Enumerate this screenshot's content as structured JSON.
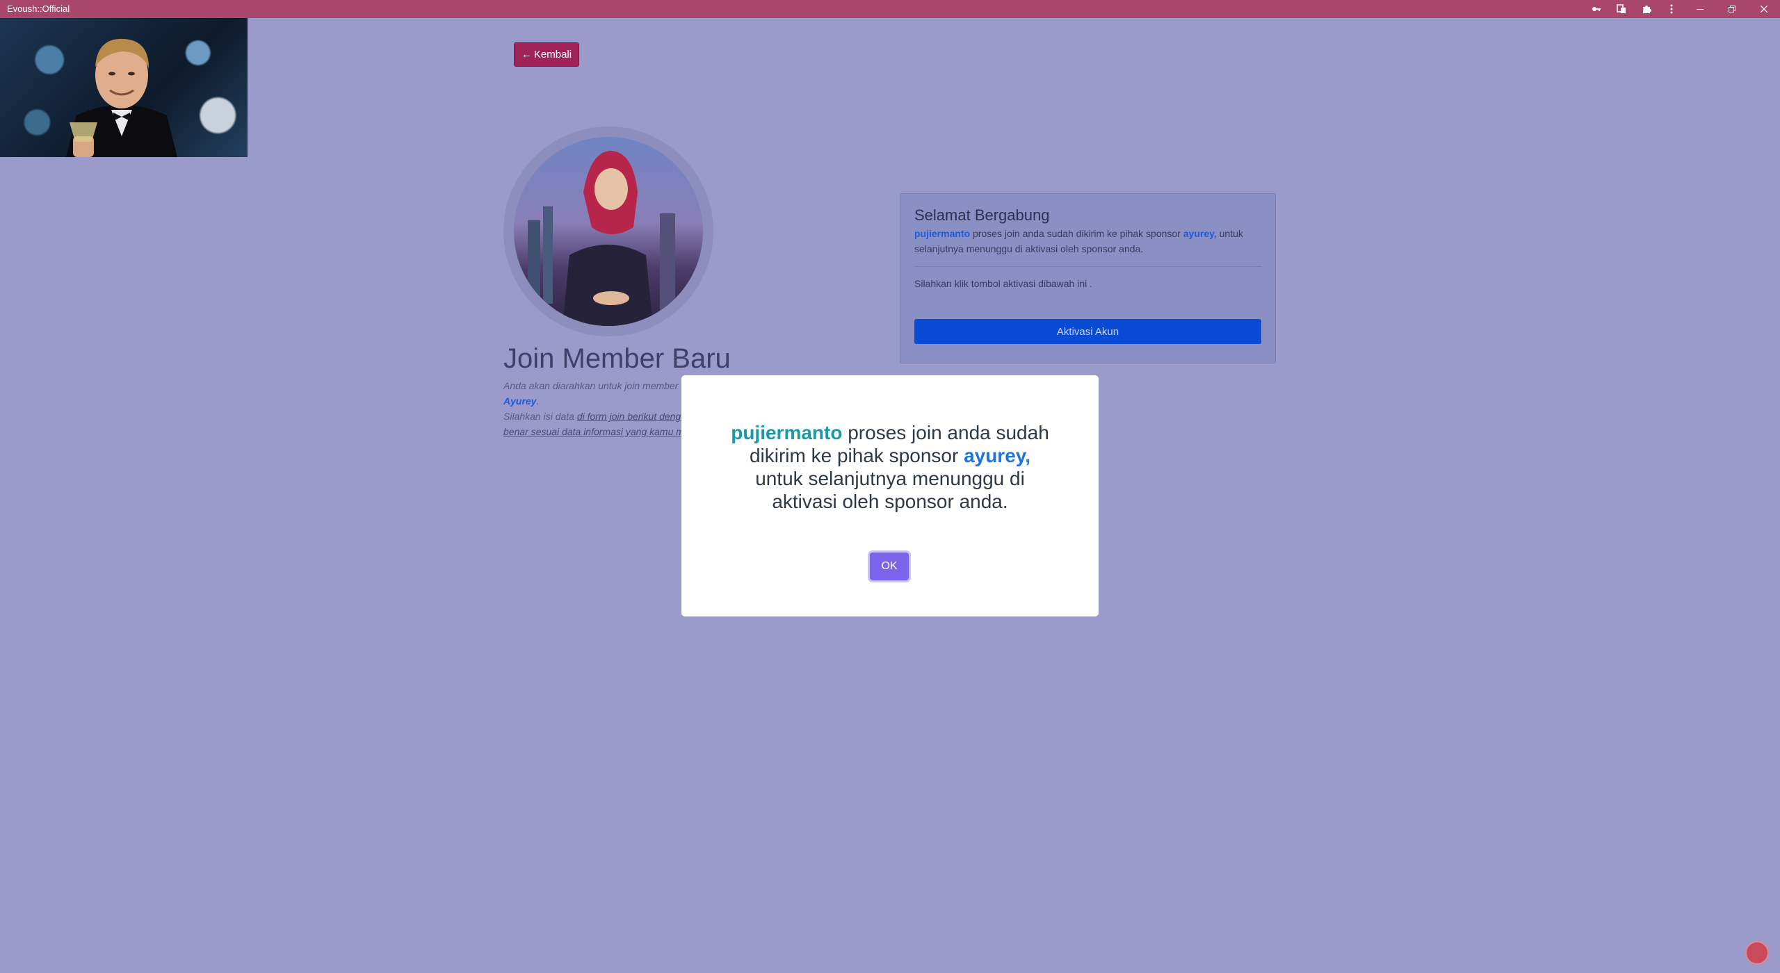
{
  "window": {
    "title": "Evoush::Official"
  },
  "back_button": {
    "label": "Kembali",
    "arrow": "←"
  },
  "join": {
    "title": "Join Member Baru",
    "line1": "Anda akan diarahkan untuk join member",
    "sponsor": "Ayurey",
    "line3_prefix": "Silahkan isi data ",
    "line3_link": "di form join berikut dengan",
    "line4": "benar sesuai data informasi yang kamu miliki"
  },
  "card": {
    "title": "Selamat Bergabung",
    "username": "pujiermanto",
    "msg_part1": " proses join anda sudah dikirim ke pihak sponsor ",
    "sponsor": "ayurey,",
    "msg_part2": " untuk selanjutnya menunggu di aktivasi oleh sponsor anda.",
    "hint": "Silahkan klik tombol aktivasi dibawah ini .",
    "activate_label": "Aktivasi Akun"
  },
  "modal": {
    "username": "pujiermanto",
    "part1": " proses join anda sudah dikirim ke pihak sponsor ",
    "sponsor": "ayurey,",
    "part2": " untuk selanjutnya menunggu di aktivasi oleh sponsor anda.",
    "ok_label": "OK"
  },
  "icons": {
    "key": "key-icon",
    "translate": "translate-icon",
    "extensions": "puzzle-icon",
    "menu": "more-vert-icon",
    "minimize": "minimize-icon",
    "restore": "restore-icon",
    "close": "close-icon"
  }
}
